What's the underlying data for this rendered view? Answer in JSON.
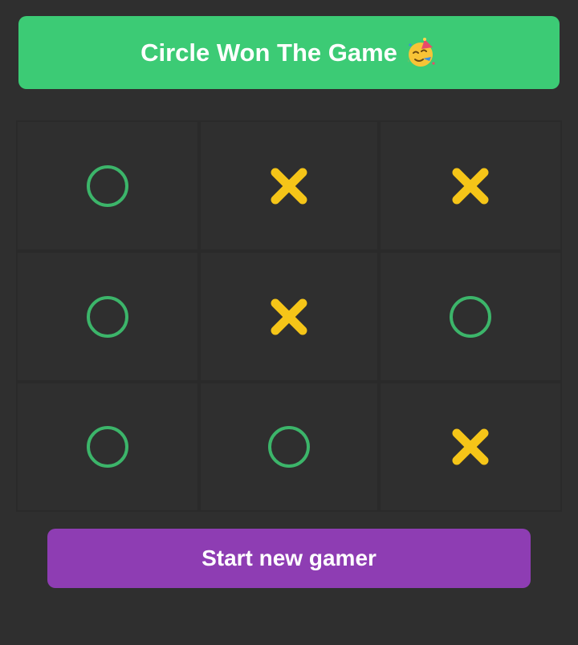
{
  "status": {
    "message": "Circle Won The Game",
    "emoji_icon": "party-face-icon"
  },
  "board": {
    "cells": [
      "O",
      "X",
      "X",
      "O",
      "X",
      "O",
      "O",
      "O",
      "X"
    ],
    "colors": {
      "O": "#3cb56a",
      "X": "#f5c518"
    }
  },
  "actions": {
    "restart_label": "Start new gamer"
  },
  "theme": {
    "background": "#2f2f2f",
    "banner": "#3ccb75",
    "button": "#8e3db3"
  }
}
